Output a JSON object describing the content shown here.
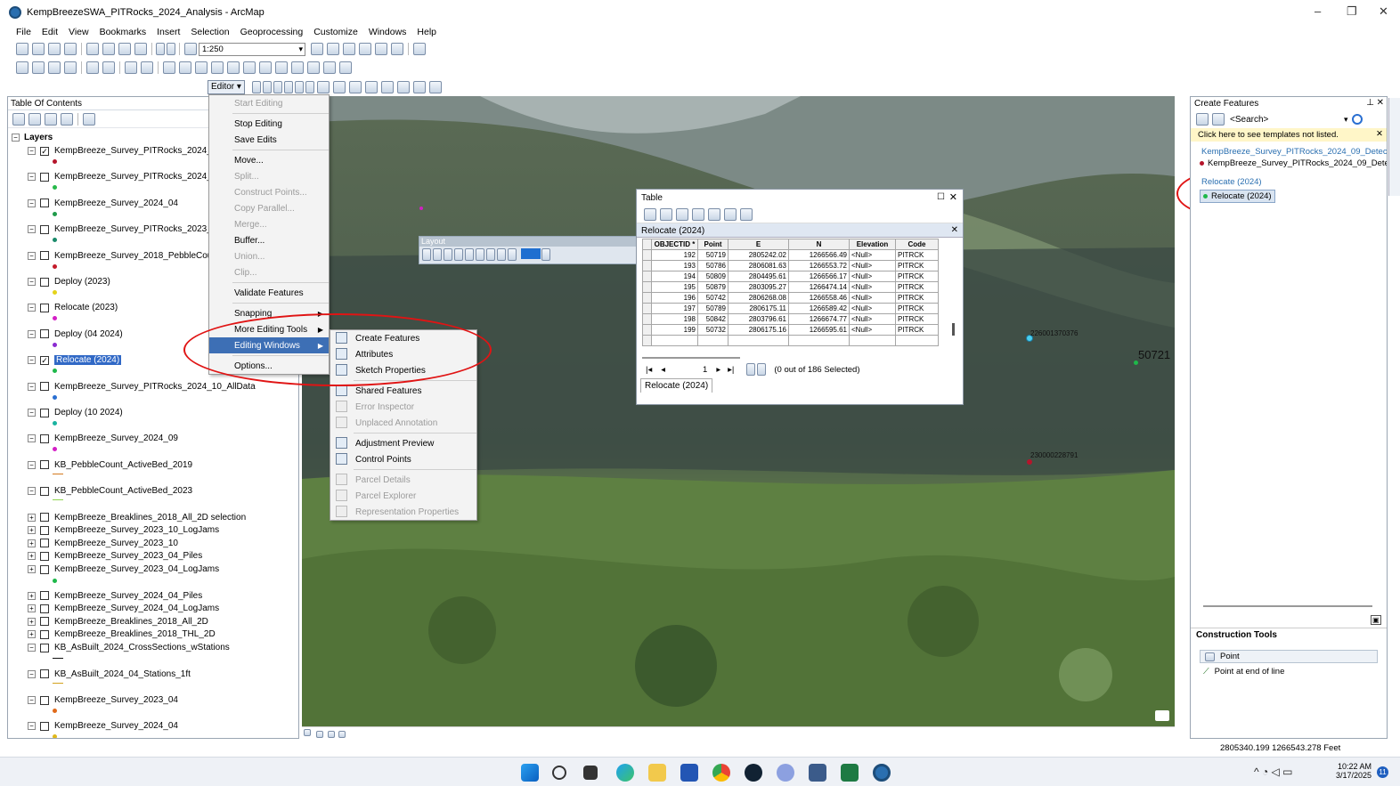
{
  "window": {
    "title": "KempBreezeSWA_PITRocks_2024_Analysis - ArcMap",
    "minimize": "–",
    "maximize": "❐",
    "close": "✕"
  },
  "menubar": [
    "File",
    "Edit",
    "View",
    "Bookmarks",
    "Insert",
    "Selection",
    "Geoprocessing",
    "Customize",
    "Windows",
    "Help"
  ],
  "toolbar": {
    "scale": "1:250",
    "editor_label": "Editor"
  },
  "toc": {
    "title": "Table Of Contents",
    "root": "Layers",
    "layers": [
      {
        "name": "KempBreeze_Survey_PITRocks_2024_09_D",
        "checked": true,
        "sym": "#b5152b"
      },
      {
        "name": "KempBreeze_Survey_PITRocks_2024_09_A",
        "checked": false,
        "sym": "#27b94a"
      },
      {
        "name": "KempBreeze_Survey_2024_04",
        "checked": false,
        "sym": "#1f9a4a"
      },
      {
        "name": "KempBreeze_Survey_PITRocks_2023_09_A",
        "checked": false,
        "sym": "#1a8a6a"
      },
      {
        "name": "KempBreeze_Survey_2018_PebbleCounts",
        "checked": false,
        "sym": "#c41b2b"
      },
      {
        "name": "Deploy (2023)",
        "checked": false,
        "sym": "#e4d31a"
      },
      {
        "name": "Relocate (2023)",
        "checked": false,
        "sym": "#d41fc6"
      },
      {
        "name": "Deploy (04 2024)",
        "checked": false,
        "sym": "#8b2bd1"
      },
      {
        "name": "Relocate (2024)",
        "checked": true,
        "sym": "#1eb84a",
        "selected": true
      },
      {
        "name": "KempBreeze_Survey_PITRocks_2024_10_AllData",
        "checked": false,
        "sym": "#2a6fd1"
      },
      {
        "name": "Deploy (10 2024)",
        "checked": false,
        "sym": "#1ab3a0"
      },
      {
        "name": "KempBreeze_Survey_2024_09",
        "checked": false,
        "sym": "#d41fc6"
      },
      {
        "name": "KB_PebbleCount_ActiveBed_2019",
        "checked": false,
        "sym": "#d47a1f"
      },
      {
        "name": "KB_PebbleCount_ActiveBed_2023",
        "checked": false,
        "sym": "#8fd44f"
      }
    ],
    "groups": [
      {
        "name": "KempBreeze_Breaklines_2018_All_2D selection",
        "exp": "+"
      },
      {
        "name": "KempBreeze_Survey_2023_10_LogJams",
        "exp": "+"
      },
      {
        "name": "KempBreeze_Survey_2023_10",
        "exp": "+"
      },
      {
        "name": "KempBreeze_Survey_2023_04_Piles",
        "exp": "+"
      },
      {
        "name": "KempBreeze_Survey_2023_04_LogJams",
        "exp": "+"
      }
    ],
    "groups2": [
      {
        "name": "KempBreeze_Survey_2024_04_Piles",
        "exp": "+"
      },
      {
        "name": "KempBreeze_Survey_2024_04_LogJams",
        "exp": "+"
      },
      {
        "name": "KempBreeze_Breaklines_2018_All_2D",
        "exp": "+"
      },
      {
        "name": "KempBreeze_Breaklines_2018_THL_2D",
        "exp": "+"
      },
      {
        "name": "KB_AsBuilt_2024_CrossSections_wStations",
        "exp": "−"
      }
    ],
    "tail": [
      {
        "name": "KB_AsBuilt_2024_04_Stations_1ft",
        "sym": "#d4a31f"
      },
      {
        "name": "KempBreeze_Survey_2023_04",
        "sym": "#e06a1a"
      },
      {
        "name": "KempBreeze_Survey_2024_04",
        "sym": "#e0b81a"
      }
    ]
  },
  "editor_menu": [
    {
      "label": "Start Editing",
      "disabled": true
    },
    {
      "label": "Stop Editing",
      "disabled": false
    },
    {
      "label": "Save Edits",
      "disabled": false
    },
    {
      "label": "Move...",
      "disabled": false
    },
    {
      "label": "Split...",
      "disabled": true
    },
    {
      "label": "Construct Points...",
      "disabled": true
    },
    {
      "label": "Copy Parallel...",
      "disabled": true
    },
    {
      "label": "Merge...",
      "disabled": true
    },
    {
      "label": "Buffer...",
      "disabled": false
    },
    {
      "label": "Union...",
      "disabled": true
    },
    {
      "label": "Clip...",
      "disabled": true
    },
    {
      "label": "Validate Features",
      "disabled": false
    },
    {
      "label": "Snapping",
      "disabled": false,
      "sub": true
    },
    {
      "label": "More Editing Tools",
      "disabled": false,
      "sub": true
    },
    {
      "label": "Editing Windows",
      "disabled": false,
      "sub": true,
      "highlight": true
    },
    {
      "label": "Options...",
      "disabled": false
    }
  ],
  "editing_windows_menu": [
    {
      "label": "Create Features",
      "disabled": false
    },
    {
      "label": "Attributes",
      "disabled": false
    },
    {
      "label": "Sketch Properties",
      "disabled": false
    },
    {
      "label": "Shared Features",
      "disabled": false
    },
    {
      "label": "Error Inspector",
      "disabled": true
    },
    {
      "label": "Unplaced Annotation",
      "disabled": true
    },
    {
      "label": "Adjustment Preview",
      "disabled": false
    },
    {
      "label": "Control Points",
      "disabled": false
    },
    {
      "label": "Parcel Details",
      "disabled": true
    },
    {
      "label": "Parcel Explorer",
      "disabled": true
    },
    {
      "label": "Representation Properties",
      "disabled": true
    }
  ],
  "layout_toolbar": {
    "title": "Layout"
  },
  "table": {
    "title": "Table",
    "layer": "Relocate (2024)",
    "columns": [
      "OBJECTID *",
      "Point",
      "E",
      "N",
      "Elevation",
      "Code"
    ],
    "rows": [
      [
        "192",
        "50719",
        "2805242.02",
        "1266566.49",
        "<Null>",
        "PITRCK"
      ],
      [
        "193",
        "50786",
        "2806081.63",
        "1266553.72",
        "<Null>",
        "PITRCK"
      ],
      [
        "194",
        "50809",
        "2804495.61",
        "1266566.17",
        "<Null>",
        "PITRCK"
      ],
      [
        "195",
        "50879",
        "2803095.27",
        "1266474.14",
        "<Null>",
        "PITRCK"
      ],
      [
        "196",
        "50742",
        "2806268.08",
        "1266558.46",
        "<Null>",
        "PITRCK"
      ],
      [
        "197",
        "50789",
        "2806175.11",
        "1266589.42",
        "<Null>",
        "PITRCK"
      ],
      [
        "198",
        "50842",
        "2803796.61",
        "1266674.77",
        "<Null>",
        "PITRCK"
      ],
      [
        "199",
        "50732",
        "2806175.16",
        "1266595.61",
        "<Null>",
        "PITRCK"
      ]
    ],
    "page": "1",
    "selection": "(0 out of 186 Selected)",
    "tab": "Relocate (2024)"
  },
  "map_labels": {
    "pt1": "226001370376",
    "pt2": "50721",
    "pt3": "230000228791"
  },
  "create_features": {
    "title": "Create Features",
    "search": "<Search>",
    "notice": "Click here to see templates not listed.",
    "group1": "KempBreeze_Survey_PITRocks_2024_09_Detection",
    "item1": "KempBreeze_Survey_PITRocks_2024_09_Detection",
    "group2": "Relocate (2024)",
    "item2": "Relocate (2024)",
    "construction_title": "Construction Tools",
    "tools": [
      "Point",
      "Point at end of line"
    ]
  },
  "status": {
    "coords": "2805340.199  1266543.278 Feet"
  },
  "clock": {
    "time": "10:22 AM",
    "date": "3/17/2025",
    "badge": "11"
  }
}
